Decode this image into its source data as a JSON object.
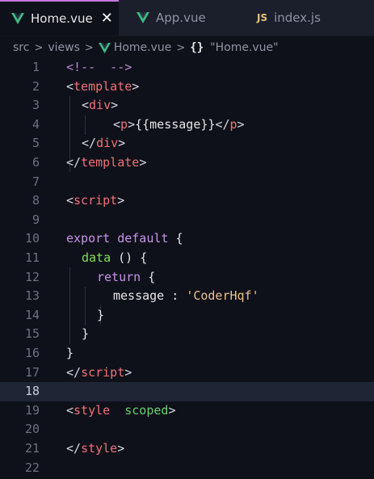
{
  "tabs": [
    {
      "label": "Home.vue",
      "icon": "vue-icon",
      "active": true,
      "close": "✕"
    },
    {
      "label": "App.vue",
      "icon": "vue-icon",
      "active": false
    },
    {
      "label": "index.js",
      "icon": "js-icon",
      "icon_text": "JS",
      "active": false
    }
  ],
  "breadcrumb": {
    "items": [
      "src",
      "views",
      "Home.vue",
      "\"Home.vue\""
    ],
    "separator": ">",
    "braces": "{}"
  },
  "editor": {
    "current_line": 18,
    "lines": [
      {
        "n": "1"
      },
      {
        "n": "2"
      },
      {
        "n": "3"
      },
      {
        "n": "4"
      },
      {
        "n": "5"
      },
      {
        "n": "6"
      },
      {
        "n": "7"
      },
      {
        "n": "8"
      },
      {
        "n": "9"
      },
      {
        "n": "10"
      },
      {
        "n": "11"
      },
      {
        "n": "12"
      },
      {
        "n": "13"
      },
      {
        "n": "14"
      },
      {
        "n": "15"
      },
      {
        "n": "16"
      },
      {
        "n": "17"
      },
      {
        "n": "18"
      },
      {
        "n": "19"
      },
      {
        "n": "20"
      },
      {
        "n": "21"
      },
      {
        "n": "22"
      }
    ],
    "tokens": {
      "l1_comment": "<!--  -->",
      "l2_open": "<",
      "l2_tag": "template",
      "l2_close": ">",
      "l3_open": "<",
      "l3_tag": "div",
      "l3_close": ">",
      "l4_open": "<",
      "l4_tag": "p",
      "l4_close": ">",
      "l4_text": "{{message}}",
      "l4_eopen": "</",
      "l4_etag": "p",
      "l4_eclose": ">",
      "l5_open": "</",
      "l5_tag": "div",
      "l5_close": ">",
      "l6_open": "</",
      "l6_tag": "template",
      "l6_close": ">",
      "l8_open": "<",
      "l8_tag": "script",
      "l8_close": ">",
      "l10_kw1": "export",
      "l10_kw2": "default",
      "l10_brace": "{",
      "l11_fn": "data",
      "l11_rest": " () {",
      "l12_kw": "return",
      "l12_brace": " {",
      "l13_key": "message",
      "l13_colon": " : ",
      "l13_str": "'CoderHqf'",
      "l14_brace": "}",
      "l15_brace": "}",
      "l16_brace": "}",
      "l17_open": "</",
      "l17_tag": "script",
      "l17_close": ">",
      "l19_open": "<",
      "l19_tag": "style",
      "l19_attr": "scoped",
      "l19_close": ">",
      "l21_open": "</",
      "l21_tag": "style",
      "l21_close": ">"
    }
  },
  "colors": {
    "background": "#0f111a",
    "tab_bar": "#1b1e2b",
    "active_tab_accent": "#c678dd",
    "tag": "#f07178",
    "keyword": "#c792ea",
    "function": "#82e05a",
    "string": "#ecc48d",
    "attribute": "#66d26d",
    "current_line": "#1f2535"
  }
}
